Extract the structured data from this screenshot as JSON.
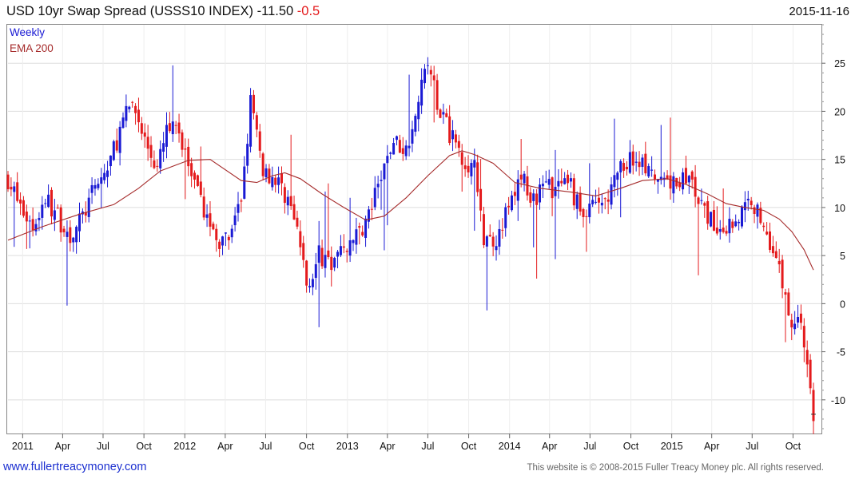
{
  "title": {
    "name": "USD 10yr Swap Spread (USSS10 INDEX)",
    "last": "-11.50",
    "change": "-0.5"
  },
  "date": "2015-11-16",
  "legend": {
    "series1": "Weekly",
    "series2": "EMA 200"
  },
  "footer": {
    "url": "www.fullertreacymoney.com",
    "copyright": "This website is © 2008-2015 Fuller Treacy Money plc. All rights reserved."
  },
  "colors": {
    "up": "#1a1ad4",
    "down": "#e41a1c",
    "ema": "#a52a2a",
    "grid": "#dddddd",
    "text": "#111111"
  },
  "chart_data": {
    "type": "candlestick",
    "frequency": "weekly",
    "x_range": [
      "2010-11-29",
      "2015-11-16"
    ],
    "ylim": [
      -13.5,
      29
    ],
    "y_ticks": [
      25,
      20,
      15,
      10,
      5,
      0,
      -5,
      -10
    ],
    "x_ticks": [
      {
        "label": "2011",
        "date": "2011-01-01"
      },
      {
        "label": "Apr",
        "date": "2011-04-01"
      },
      {
        "label": "Jul",
        "date": "2011-07-01"
      },
      {
        "label": "Oct",
        "date": "2011-10-01"
      },
      {
        "label": "2012",
        "date": "2012-01-01"
      },
      {
        "label": "Apr",
        "date": "2012-04-01"
      },
      {
        "label": "Jul",
        "date": "2012-07-01"
      },
      {
        "label": "Oct",
        "date": "2012-10-01"
      },
      {
        "label": "2013",
        "date": "2013-01-01"
      },
      {
        "label": "Apr",
        "date": "2013-04-01"
      },
      {
        "label": "Jul",
        "date": "2013-07-01"
      },
      {
        "label": "Oct",
        "date": "2013-10-01"
      },
      {
        "label": "2014",
        "date": "2014-01-01"
      },
      {
        "label": "Apr",
        "date": "2014-04-01"
      },
      {
        "label": "Jul",
        "date": "2014-07-01"
      },
      {
        "label": "Oct",
        "date": "2014-10-01"
      },
      {
        "label": "2015",
        "date": "2015-01-01"
      },
      {
        "label": "Apr",
        "date": "2015-04-01"
      },
      {
        "label": "Jul",
        "date": "2015-07-01"
      },
      {
        "label": "Oct",
        "date": "2015-10-01"
      }
    ],
    "grid": true,
    "legend_position": "top-left",
    "close_path": [
      [
        "2010-11-29",
        13
      ],
      [
        "2010-12-27",
        10
      ],
      [
        "2011-01-24",
        8
      ],
      [
        "2011-02-21",
        11
      ],
      [
        "2011-03-21",
        9
      ],
      [
        "2011-04-18",
        7
      ],
      [
        "2011-05-16",
        9
      ],
      [
        "2011-06-13",
        12
      ],
      [
        "2011-07-11",
        14
      ],
      [
        "2011-08-08",
        18
      ],
      [
        "2011-09-05",
        21
      ],
      [
        "2011-10-03",
        17
      ],
      [
        "2011-10-31",
        14
      ],
      [
        "2011-11-28",
        19
      ],
      [
        "2011-12-26",
        17
      ],
      [
        "2012-01-23",
        12
      ],
      [
        "2012-02-20",
        9
      ],
      [
        "2012-03-19",
        6
      ],
      [
        "2012-04-16",
        7
      ],
      [
        "2012-05-07",
        11
      ],
      [
        "2012-05-28",
        21
      ],
      [
        "2012-06-25",
        14
      ],
      [
        "2012-07-23",
        13
      ],
      [
        "2012-08-20",
        11
      ],
      [
        "2012-09-17",
        6
      ],
      [
        "2012-10-01",
        2
      ],
      [
        "2012-10-29",
        5
      ],
      [
        "2012-11-26",
        4
      ],
      [
        "2012-12-24",
        6
      ],
      [
        "2013-01-21",
        7
      ],
      [
        "2013-02-18",
        9
      ],
      [
        "2013-03-18",
        13
      ],
      [
        "2013-04-15",
        17
      ],
      [
        "2013-05-13",
        16
      ],
      [
        "2013-06-10",
        22
      ],
      [
        "2013-07-01",
        25
      ],
      [
        "2013-07-29",
        20
      ],
      [
        "2013-08-26",
        17
      ],
      [
        "2013-09-23",
        15
      ],
      [
        "2013-10-14",
        14
      ],
      [
        "2013-11-04",
        6
      ],
      [
        "2013-12-02",
        7
      ],
      [
        "2013-12-30",
        10
      ],
      [
        "2014-01-27",
        13
      ],
      [
        "2014-02-24",
        11
      ],
      [
        "2014-03-24",
        12
      ],
      [
        "2014-04-21",
        12
      ],
      [
        "2014-05-19",
        12
      ],
      [
        "2014-06-16",
        9
      ],
      [
        "2014-07-14",
        10
      ],
      [
        "2014-08-11",
        11
      ],
      [
        "2014-09-08",
        14
      ],
      [
        "2014-09-29",
        15
      ],
      [
        "2014-10-20",
        15
      ],
      [
        "2014-11-17",
        13
      ],
      [
        "2014-12-15",
        12
      ],
      [
        "2015-01-12",
        13
      ],
      [
        "2015-02-09",
        13
      ],
      [
        "2015-03-09",
        10
      ],
      [
        "2015-04-06",
        8
      ],
      [
        "2015-05-04",
        8
      ],
      [
        "2015-06-01",
        9
      ],
      [
        "2015-06-29",
        11
      ],
      [
        "2015-07-27",
        8
      ],
      [
        "2015-08-17",
        6
      ],
      [
        "2015-09-07",
        2
      ],
      [
        "2015-09-28",
        -2
      ],
      [
        "2015-10-19",
        -1.5
      ],
      [
        "2015-11-02",
        -7
      ],
      [
        "2015-11-16",
        -11.5
      ]
    ],
    "ema_200": [
      [
        "2010-11-29",
        6.6
      ],
      [
        "2011-02-14",
        8.0
      ],
      [
        "2011-05-09",
        9.3
      ],
      [
        "2011-07-25",
        10.3
      ],
      [
        "2011-09-19",
        12.0
      ],
      [
        "2011-11-07",
        13.8
      ],
      [
        "2012-01-09",
        14.9
      ],
      [
        "2012-02-27",
        15.0
      ],
      [
        "2012-05-07",
        12.8
      ],
      [
        "2012-06-11",
        12.6
      ],
      [
        "2012-07-16",
        13.3
      ],
      [
        "2012-08-13",
        13.6
      ],
      [
        "2012-09-17",
        13.0
      ],
      [
        "2012-11-05",
        11.4
      ],
      [
        "2012-12-24",
        10.0
      ],
      [
        "2013-02-11",
        8.7
      ],
      [
        "2013-03-25",
        9.1
      ],
      [
        "2013-05-13",
        11.0
      ],
      [
        "2013-07-01",
        13.3
      ],
      [
        "2013-08-19",
        15.4
      ],
      [
        "2013-09-16",
        15.9
      ],
      [
        "2013-10-14",
        15.5
      ],
      [
        "2013-11-25",
        14.6
      ],
      [
        "2014-01-13",
        12.6
      ],
      [
        "2014-03-10",
        12.0
      ],
      [
        "2014-05-19",
        11.6
      ],
      [
        "2014-07-14",
        11.2
      ],
      [
        "2014-09-08",
        12.0
      ],
      [
        "2014-10-27",
        12.8
      ],
      [
        "2014-12-22",
        13.0
      ],
      [
        "2015-02-02",
        12.4
      ],
      [
        "2015-03-23",
        11.4
      ],
      [
        "2015-05-04",
        10.4
      ],
      [
        "2015-06-15",
        10.0
      ],
      [
        "2015-07-27",
        9.7
      ],
      [
        "2015-08-31",
        8.8
      ],
      [
        "2015-09-28",
        7.5
      ],
      [
        "2015-10-26",
        5.6
      ],
      [
        "2015-11-16",
        3.5
      ]
    ],
    "series": [
      {
        "name": "Weekly",
        "kind": "weekly OHLC bars"
      },
      {
        "name": "EMA 200",
        "kind": "line"
      }
    ]
  }
}
